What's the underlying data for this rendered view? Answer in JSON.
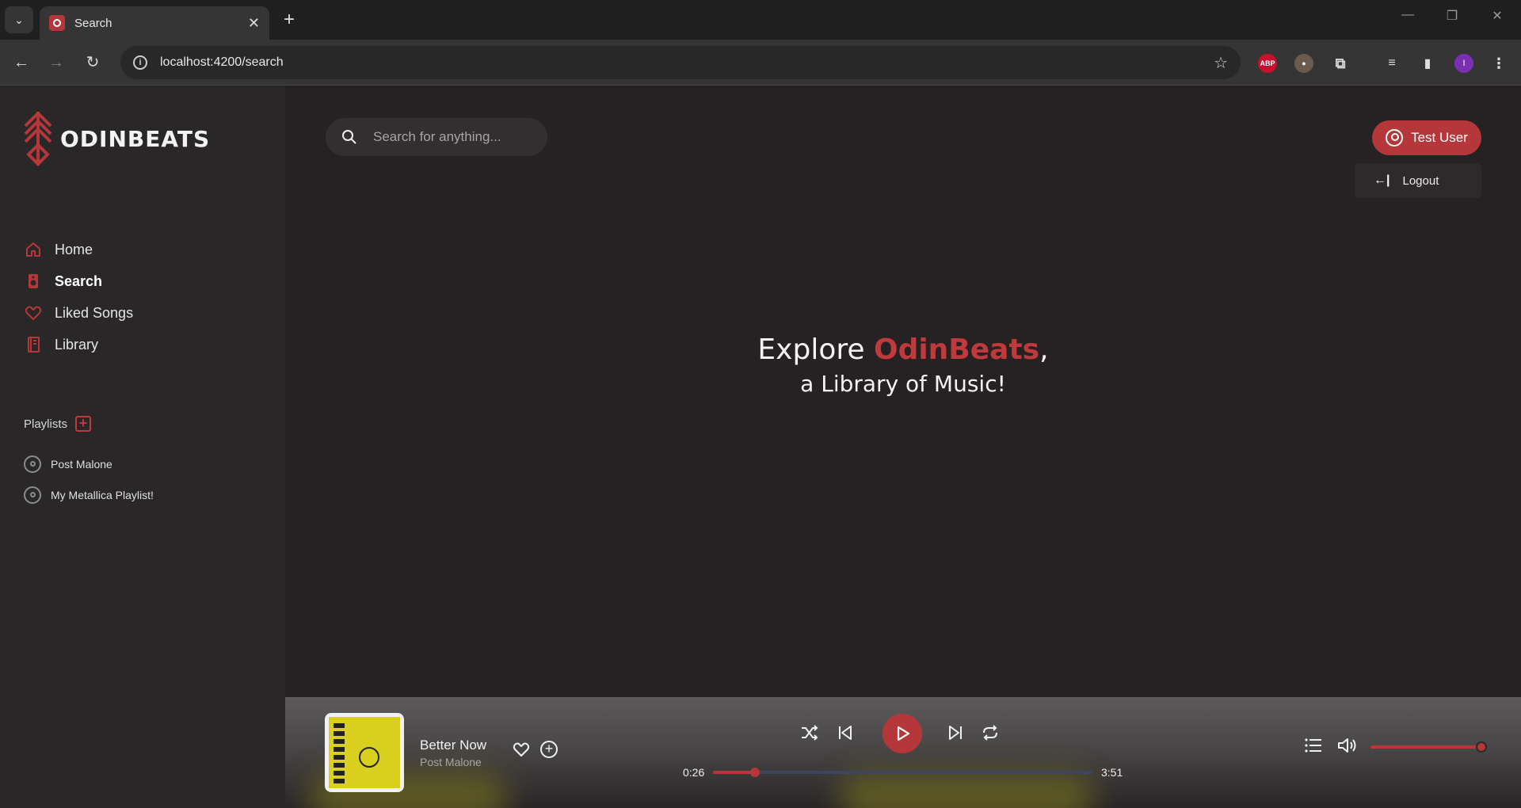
{
  "browser": {
    "tab_title": "Search",
    "url": "localhost:4200/search",
    "profile_initial": "I",
    "abp_label": "ABP"
  },
  "brand": {
    "name": "ODINBEATS",
    "accent_color": "#b5373a"
  },
  "nav": {
    "items": [
      {
        "label": "Home",
        "icon": "home-icon"
      },
      {
        "label": "Search",
        "icon": "search-speaker-icon",
        "active": true
      },
      {
        "label": "Liked Songs",
        "icon": "heart-icon"
      },
      {
        "label": "Library",
        "icon": "library-icon"
      }
    ]
  },
  "playlists": {
    "heading": "Playlists",
    "items": [
      {
        "label": "Post Malone"
      },
      {
        "label": "My Metallica Playlist!"
      }
    ]
  },
  "search": {
    "placeholder": "Search for anything..."
  },
  "user": {
    "name": "Test User",
    "logout_label": "Logout"
  },
  "hero": {
    "explore": "Explore",
    "brand": "OdinBeats",
    "comma": ",",
    "line2": "a Library of Music!"
  },
  "player": {
    "track_title": "Better Now",
    "track_artist": "Post Malone",
    "elapsed": "0:26",
    "duration": "3:51",
    "progress_fraction": 0.11,
    "volume_fraction": 1.0
  }
}
